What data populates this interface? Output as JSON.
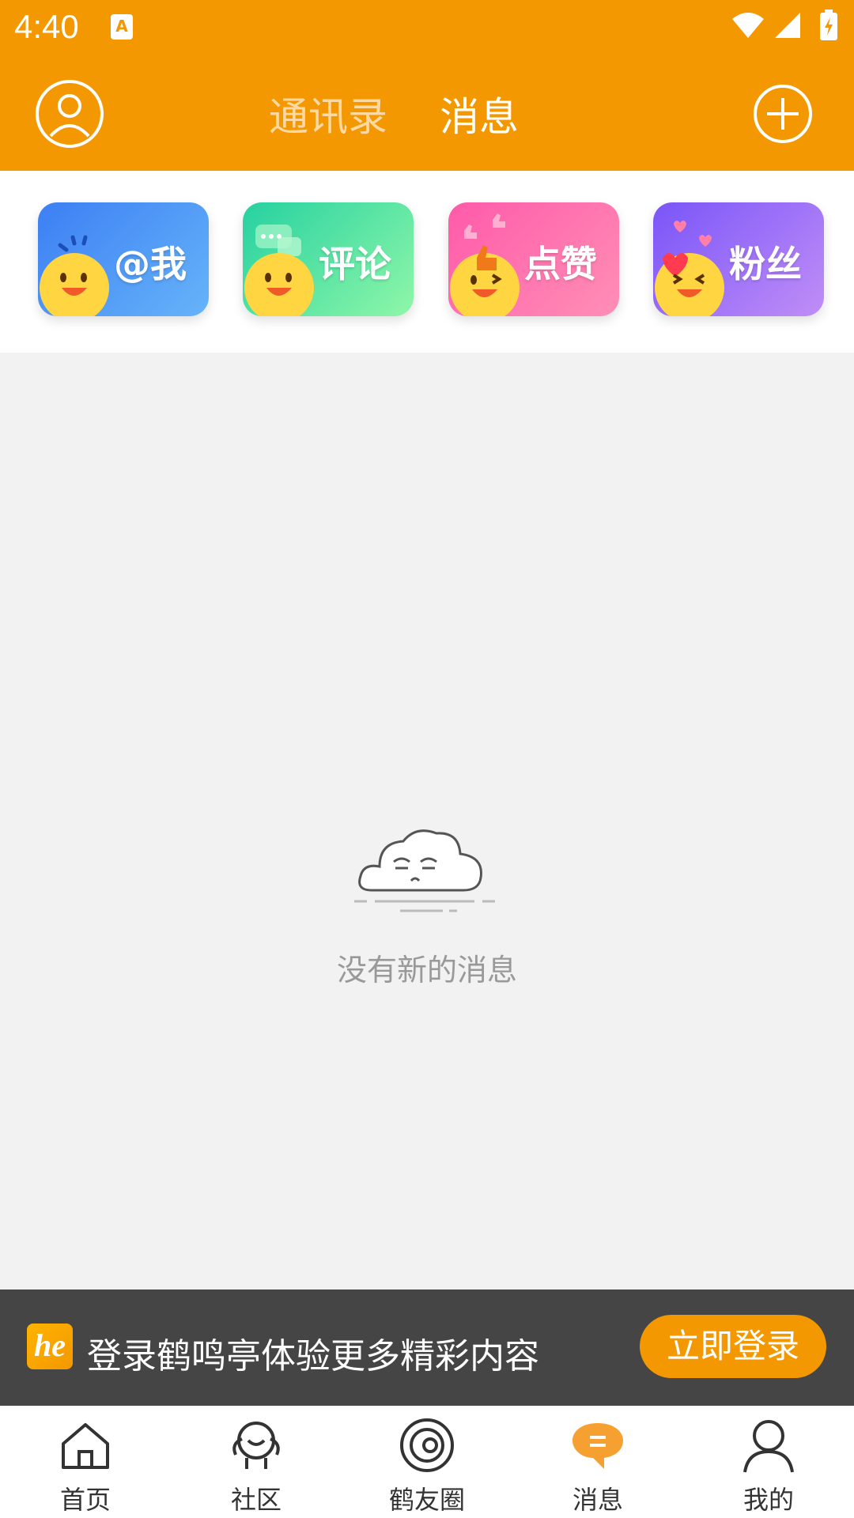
{
  "status_bar": {
    "time": "4:40",
    "notification_icon": "A"
  },
  "header": {
    "tabs": [
      {
        "label": "通讯录",
        "active": false
      },
      {
        "label": "消息",
        "active": true
      }
    ],
    "icons": {
      "left": "profile-icon",
      "right": "plus-circle-icon"
    }
  },
  "categories": [
    {
      "label": "@我",
      "icon": "mention-smiley-icon"
    },
    {
      "label": "评论",
      "icon": "comment-smiley-icon"
    },
    {
      "label": "点赞",
      "icon": "like-smiley-icon"
    },
    {
      "label": "粉丝",
      "icon": "fan-smiley-icon"
    }
  ],
  "empty_state": {
    "message": "没有新的消息",
    "icon": "sleepy-cloud-icon"
  },
  "login_banner": {
    "logo_text": "he",
    "text": "登录鹤鸣亭体验更多精彩内容",
    "button": "立即登录"
  },
  "bottom_nav": [
    {
      "label": "首页",
      "icon": "home-icon",
      "active": false
    },
    {
      "label": "社区",
      "icon": "community-icon",
      "active": false
    },
    {
      "label": "鹤友圈",
      "icon": "circle-icon",
      "active": false
    },
    {
      "label": "消息",
      "icon": "message-icon",
      "active": true
    },
    {
      "label": "我的",
      "icon": "user-icon",
      "active": false
    }
  ],
  "colors": {
    "accent": "#f39800",
    "banner_bg": "#454545",
    "page_bg": "#f2f2f2"
  }
}
